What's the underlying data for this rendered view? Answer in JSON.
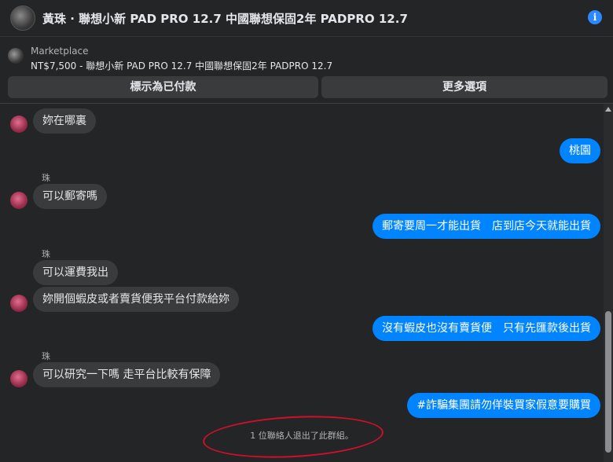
{
  "header": {
    "title": "黃珠 · 聯想小新 PAD PRO 12.7 中國聯想保固2年 PADPRO 12.7",
    "info_icon": "info-icon"
  },
  "marketplace": {
    "label": "Marketplace",
    "listing": "NT$7,500 - 聯想小新 PAD PRO 12.7 中國聯想保固2年 PADPRO 12.7",
    "mark_paid_button": "標示為已付款",
    "more_options_button": "更多選項"
  },
  "chat": {
    "messages": [
      {
        "dir": "in",
        "text": "妳在哪裏"
      },
      {
        "dir": "out",
        "text": "桃園"
      },
      {
        "dir": "in",
        "sender": "珠",
        "text": "可以郵寄嗎"
      },
      {
        "dir": "out",
        "text": "郵寄要周一才能出貨　店到店今天就能出貨"
      },
      {
        "dir": "in",
        "sender": "珠",
        "text": "可以運費我出"
      },
      {
        "dir": "in",
        "text": "妳開個蝦皮或者賣貨便我平台付款給妳"
      },
      {
        "dir": "out",
        "text": "沒有蝦皮也沒有賣貨便　只有先匯款後出貨"
      },
      {
        "dir": "in",
        "sender": "珠",
        "text": "可以研究一下嗎 走平台比較有保障"
      },
      {
        "dir": "out",
        "text": "#詐騙集團請勿佯裝買家假意要購買"
      }
    ],
    "system_notice": "1 位聯絡人退出了此群組。"
  },
  "colors": {
    "outgoing_bubble": "#0084ff",
    "incoming_bubble": "#3a3b3c",
    "annotation_circle": "#d0102a"
  }
}
